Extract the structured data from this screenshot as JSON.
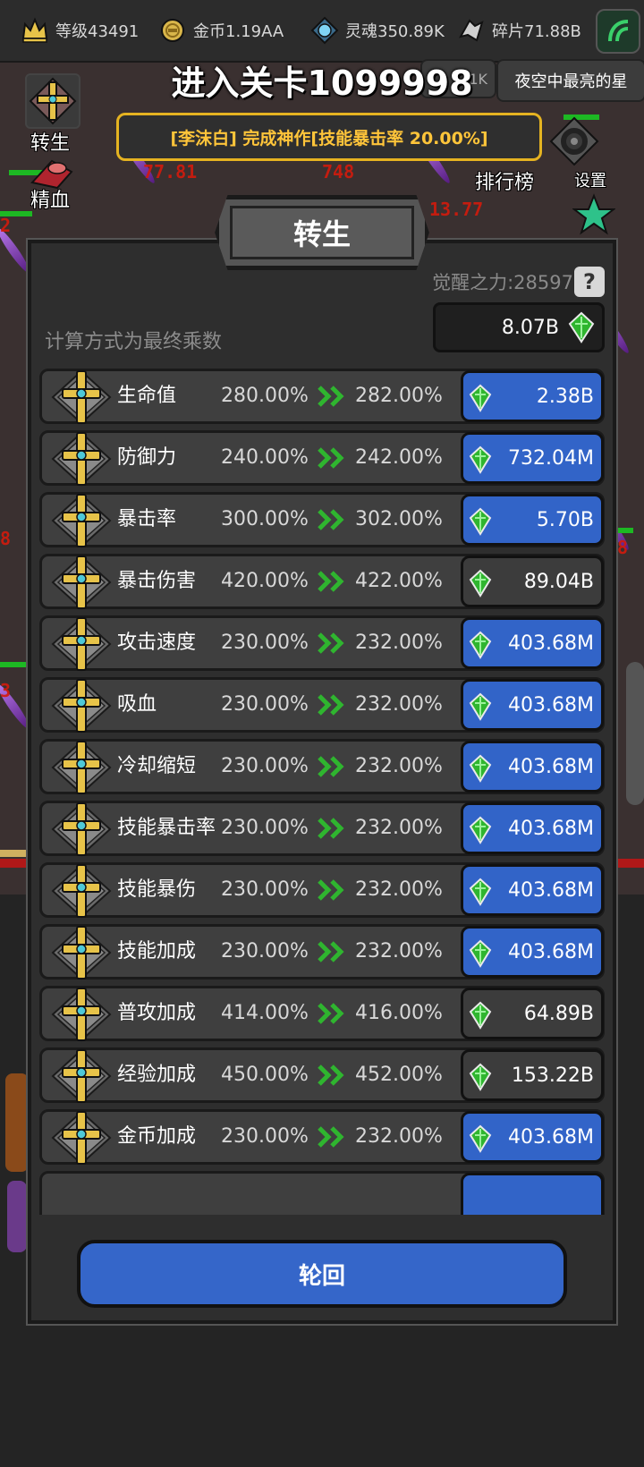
{
  "topbar": {
    "level": "等级43491",
    "gold": "金币1.19AA",
    "soul": "灵魂350.89K",
    "shards": "碎片71.88B"
  },
  "stage_title": "进入关卡1099998",
  "rank_tab": "夜空中最亮的星",
  "mid_tab_fragment": "1K",
  "announcement": "[李沫白] 完成神作[技能暴击率 20.00%]",
  "side": {
    "rebirth": "转生",
    "blood": "精血",
    "ranking": "排行榜",
    "settings": "设置"
  },
  "panel": {
    "title": "转生",
    "awaken_label": "觉醒之力:28597",
    "help": "?",
    "balance": "8.07B",
    "formula_note": "计算方式为最终乘数"
  },
  "rows": [
    {
      "name": "生命值",
      "current": "280.00%",
      "next": "282.00%",
      "cost": "2.38B",
      "affordable": true
    },
    {
      "name": "防御力",
      "current": "240.00%",
      "next": "242.00%",
      "cost": "732.04M",
      "affordable": true
    },
    {
      "name": "暴击率",
      "current": "300.00%",
      "next": "302.00%",
      "cost": "5.70B",
      "affordable": true
    },
    {
      "name": "暴击伤害",
      "current": "420.00%",
      "next": "422.00%",
      "cost": "89.04B",
      "affordable": false
    },
    {
      "name": "攻击速度",
      "current": "230.00%",
      "next": "232.00%",
      "cost": "403.68M",
      "affordable": true
    },
    {
      "name": "吸血",
      "current": "230.00%",
      "next": "232.00%",
      "cost": "403.68M",
      "affordable": true
    },
    {
      "name": "冷却缩短",
      "current": "230.00%",
      "next": "232.00%",
      "cost": "403.68M",
      "affordable": true
    },
    {
      "name": "技能暴击率",
      "current": "230.00%",
      "next": "232.00%",
      "cost": "403.68M",
      "affordable": true
    },
    {
      "name": "技能暴伤",
      "current": "230.00%",
      "next": "232.00%",
      "cost": "403.68M",
      "affordable": true
    },
    {
      "name": "技能加成",
      "current": "230.00%",
      "next": "232.00%",
      "cost": "403.68M",
      "affordable": true
    },
    {
      "name": "普攻加成",
      "current": "414.00%",
      "next": "416.00%",
      "cost": "64.89B",
      "affordable": false
    },
    {
      "name": "经验加成",
      "current": "450.00%",
      "next": "452.00%",
      "cost": "153.22B",
      "affordable": false
    },
    {
      "name": "金币加成",
      "current": "230.00%",
      "next": "232.00%",
      "cost": "403.68M",
      "affordable": true
    }
  ],
  "reincarnate_button": "轮回",
  "colors": {
    "affordable": "#3264c8",
    "unaffordable": "#3c3c3c",
    "announce_text": "#ffc53a",
    "gem": "#2fb52f"
  }
}
